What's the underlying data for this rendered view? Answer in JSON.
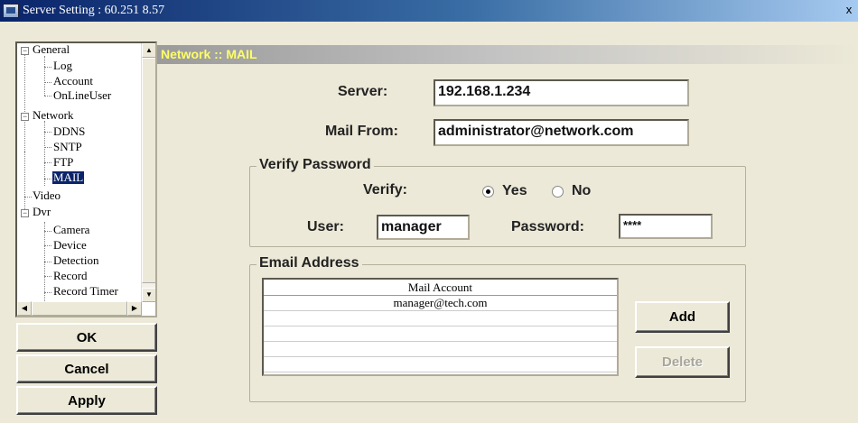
{
  "window": {
    "title": "Server Setting : 60.251 8.57",
    "close_glyph": "x"
  },
  "tree": {
    "general": "General",
    "log": "Log",
    "account": "Account",
    "online_user": "OnLineUser",
    "network": "Network",
    "ddns": "DDNS",
    "sntp": "SNTP",
    "ftp": "FTP",
    "mail": "MAIL",
    "video": "Video",
    "dvr": "Dvr",
    "camera": "Camera",
    "device": "Device",
    "detection": "Detection",
    "record": "Record",
    "record_timer": "Record Timer",
    "expand_minus": "−",
    "arrow_up": "▲",
    "arrow_down": "▼",
    "arrow_left": "◀",
    "arrow_right": "▶"
  },
  "side_buttons": {
    "ok": "OK",
    "cancel": "Cancel",
    "apply": "Apply"
  },
  "section": {
    "title": "Network :: MAIL"
  },
  "form": {
    "server_label": "Server:",
    "server_value": "192.168.1.234",
    "mail_from_label": "Mail From:",
    "mail_from_value": "administrator@network.com"
  },
  "verify": {
    "group_title": "Verify Password",
    "verify_label": "Verify:",
    "yes_label": "Yes",
    "no_label": "No",
    "selected": "Yes",
    "user_label": "User:",
    "user_value": "manager",
    "password_label": "Password:",
    "password_value": "****"
  },
  "email": {
    "group_title": "Email Address",
    "column_header": "Mail Account",
    "rows": [
      "manager@tech.com",
      "",
      "",
      "",
      ""
    ],
    "add_label": "Add",
    "delete_label": "Delete"
  },
  "colors": {
    "section_title": "#ffff66",
    "title_bar": "#0a246a",
    "selection": "#0a246a"
  }
}
